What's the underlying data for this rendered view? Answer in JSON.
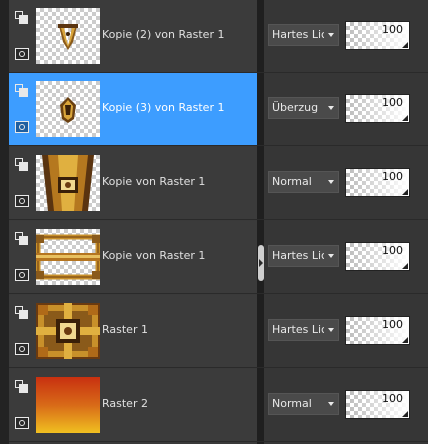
{
  "layers": [
    {
      "name": "Kopie (2) von Raster 1",
      "blend_mode": "Hartes Licht",
      "opacity": "100",
      "selected": false,
      "thumb_icon": "ornament-small-icon"
    },
    {
      "name": "Kopie (3) von Raster 1",
      "blend_mode": "Überzug",
      "opacity": "100",
      "selected": true,
      "thumb_icon": "ornament-small-icon"
    },
    {
      "name": "Kopie von Raster 1",
      "blend_mode": "Normal",
      "opacity": "100",
      "selected": false,
      "thumb_icon": "ornament-tall-icon"
    },
    {
      "name": "Kopie von Raster 1",
      "blend_mode": "Hartes Licht",
      "opacity": "100",
      "selected": false,
      "thumb_icon": "frame-icon"
    },
    {
      "name": "Raster 1",
      "blend_mode": "Hartes Licht",
      "opacity": "100",
      "selected": false,
      "thumb_icon": "tile-pattern-icon"
    },
    {
      "name": "Raster 2",
      "blend_mode": "Normal",
      "opacity": "100",
      "selected": false,
      "thumb_icon": "gradient-fill-icon"
    }
  ],
  "colors": {
    "selected_row": "#3d9dff",
    "row_bg": "#3b3b3b",
    "gold": "#c8902a",
    "dark_brown": "#4a2a10",
    "gradient_top": "#c83010",
    "gradient_bottom": "#f0c020"
  }
}
